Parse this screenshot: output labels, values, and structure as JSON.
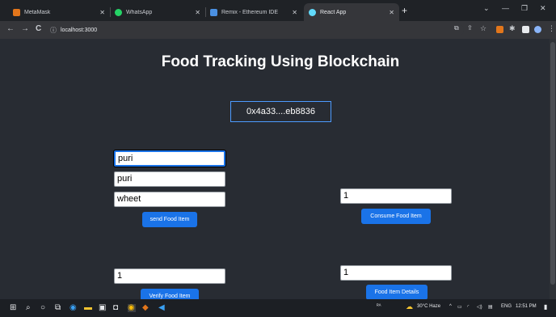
{
  "tabs": [
    {
      "title": "MetaMask",
      "color": "#e2761b"
    },
    {
      "title": "WhatsApp",
      "color": "#25d366"
    },
    {
      "title": "Remix - Ethereum IDE",
      "color": "#4a90e2"
    },
    {
      "title": "React App",
      "color": "#61dafb",
      "active": true
    }
  ],
  "address": {
    "url": "localhost:3000"
  },
  "app": {
    "title": "Food Tracking Using Blockchain",
    "account": "0x4a33....eb8836",
    "send_form": {
      "field1": "puri",
      "field2": "puri",
      "field3": "wheet",
      "button": "send Food Item"
    },
    "consume_form": {
      "field": "1",
      "button": "Consume Food Item"
    },
    "verify_form": {
      "field": "1",
      "button": "Verify Food Item"
    },
    "details_form": {
      "field": "1",
      "button": "Food Item Details"
    }
  },
  "taskbar": {
    "weather": "30°C  Haze",
    "lang": "ENG",
    "time": "12:51 PM"
  }
}
